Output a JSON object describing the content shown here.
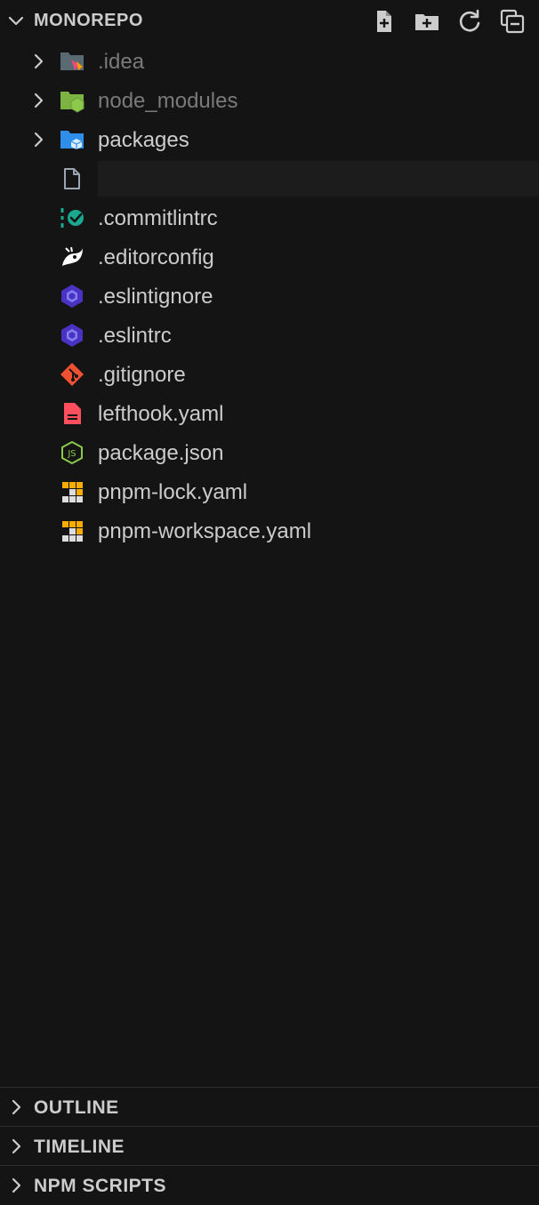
{
  "explorer": {
    "title": "MONOREPO",
    "tools": [
      {
        "name": "new-file-button",
        "icon": "new-file-icon"
      },
      {
        "name": "new-folder-button",
        "icon": "new-folder-icon"
      },
      {
        "name": "refresh-button",
        "icon": "refresh-icon"
      },
      {
        "name": "collapse-all-button",
        "icon": "collapse-all-icon"
      }
    ],
    "items": [
      {
        "label": ".idea",
        "kind": "folder",
        "icon": "idea-folder-icon",
        "dim": true
      },
      {
        "label": "node_modules",
        "kind": "folder",
        "icon": "node-folder-icon",
        "dim": true
      },
      {
        "label": "packages",
        "kind": "folder",
        "icon": "packages-folder-icon",
        "dim": false
      },
      {
        "label": "",
        "kind": "new-file-input",
        "icon": "file-icon",
        "value": ""
      },
      {
        "label": ".commitlintrc",
        "kind": "file",
        "icon": "commitlint-icon"
      },
      {
        "label": ".editorconfig",
        "kind": "file",
        "icon": "editorconfig-icon"
      },
      {
        "label": ".eslintignore",
        "kind": "file",
        "icon": "eslint-icon"
      },
      {
        "label": ".eslintrc",
        "kind": "file",
        "icon": "eslint-icon"
      },
      {
        "label": ".gitignore",
        "kind": "file",
        "icon": "git-icon"
      },
      {
        "label": "lefthook.yaml",
        "kind": "file",
        "icon": "lefthook-icon"
      },
      {
        "label": "package.json",
        "kind": "file",
        "icon": "nodejs-icon"
      },
      {
        "label": "pnpm-lock.yaml",
        "kind": "file",
        "icon": "pnpm-icon"
      },
      {
        "label": "pnpm-workspace.yaml",
        "kind": "file",
        "icon": "pnpm-icon"
      }
    ]
  },
  "panels": [
    {
      "title": "OUTLINE"
    },
    {
      "title": "TIMELINE"
    },
    {
      "title": "NPM SCRIPTS"
    }
  ],
  "colors": {
    "background": "#141414",
    "text": "#cccccc",
    "dim_text": "#7a7a7a",
    "eslint": "#4b32c3",
    "git": "#f05133",
    "node": "#8cc84b",
    "pnpm": "#f9ad00",
    "commitlint": "#1aa88f",
    "lefthook": "#ff4f5e",
    "folder_blue": "#2f8fe8"
  }
}
